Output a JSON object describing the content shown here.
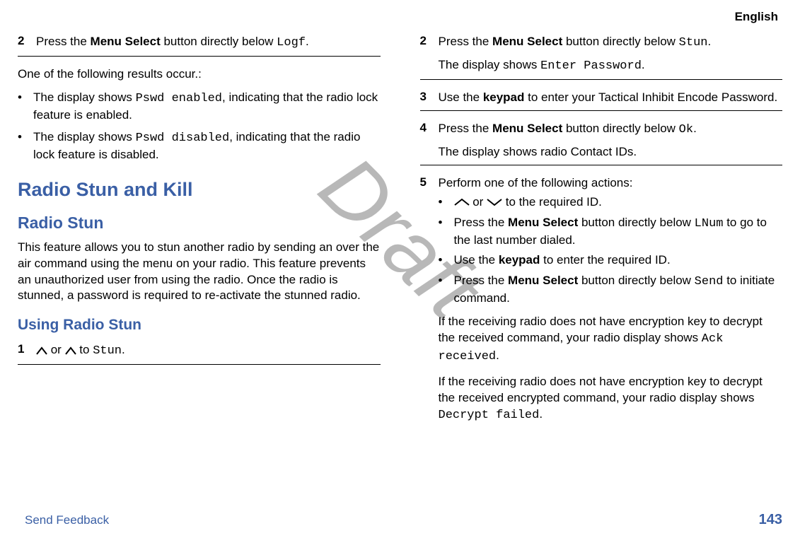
{
  "header": {
    "lang": "English"
  },
  "watermark": "Draft",
  "left": {
    "step2": {
      "num": "2",
      "pre": "Press the ",
      "bold1": "Menu Select",
      "mid": " button directly below ",
      "mono": "Logf",
      "post": "."
    },
    "results_intro": "One of the following results occur.:",
    "bullet1": {
      "pre": "The display shows ",
      "mono": "Pswd enabled",
      "post": ", indicating that the radio lock feature is enabled."
    },
    "bullet2": {
      "pre": "The display shows ",
      "mono": "Pswd disabled",
      "post": ", indicating that the radio lock feature is disabled."
    },
    "h1": "Radio Stun and Kill",
    "h2": "Radio Stun",
    "stun_para": "This feature allows you to stun another radio by sending an over the air command using the menu on your radio. This feature prevents an unauthorized user from using the radio. Once the radio is stunned, a password is required to re-activate the stunned radio.",
    "h3": "Using Radio Stun",
    "step1": {
      "num": "1",
      "mid": " or ",
      "tail": " to ",
      "mono": "Stun",
      "post": "."
    }
  },
  "right": {
    "step2": {
      "num": "2",
      "pre": "Press the ",
      "bold1": "Menu Select",
      "mid": " button directly below ",
      "mono": "Stun",
      "post": "."
    },
    "step2_result": {
      "pre": "The display shows ",
      "mono": "Enter Password",
      "post": "."
    },
    "step3": {
      "num": "3",
      "pre": "Use the ",
      "bold1": "keypad",
      "post": " to enter your Tactical Inhibit Encode Password."
    },
    "step4": {
      "num": "4",
      "pre": "Press the ",
      "bold1": "Menu Select",
      "mid": " button directly below ",
      "mono": "Ok",
      "post": "."
    },
    "step4_result": "The display shows radio Contact IDs.",
    "step5": {
      "num": "5",
      "text": "Perform one of the following actions:"
    },
    "s5_b1": {
      "mid": " or ",
      "post": " to the required ID."
    },
    "s5_b2": {
      "pre": "Press the ",
      "bold": "Menu Select",
      "mid": " button directly below ",
      "mono": "LNum",
      "post": " to go to the last number dialed."
    },
    "s5_b3": {
      "pre": "Use the ",
      "bold": "keypad",
      "post": " to enter the required ID."
    },
    "s5_b4": {
      "pre": "Press the ",
      "bold": "Menu Select",
      "mid": " button directly below ",
      "mono": "Send",
      "post": " to initiate command."
    },
    "s5_r1": {
      "pre": "If the receiving radio does not have encryption key to decrypt the received command, your radio display shows ",
      "mono": "Ack received",
      "post": "."
    },
    "s5_r2": {
      "pre": "If the receiving radio does not have encryption key to decrypt the received encrypted command, your radio display shows ",
      "mono": "Decrypt failed",
      "post": "."
    }
  },
  "footer": {
    "link": "Send Feedback",
    "page": "143"
  }
}
